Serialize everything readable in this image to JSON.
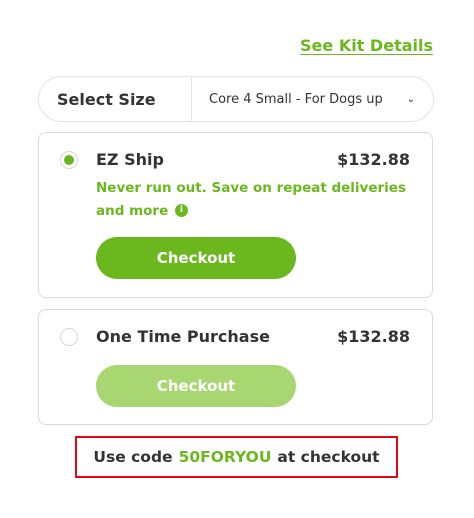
{
  "kit_link": "See Kit Details",
  "size": {
    "label": "Select Size",
    "selected": "Core 4 Small - For Dogs up"
  },
  "options": [
    {
      "title": "EZ Ship",
      "price": "$132.88",
      "selected": true,
      "promo": "Never run out. Save on repeat deliveries and more",
      "button": "Checkout"
    },
    {
      "title": "One Time Purchase",
      "price": "$132.88",
      "selected": false,
      "button": "Checkout"
    }
  ],
  "code_banner": {
    "prefix": "Use code",
    "code": "50FORYOU",
    "suffix": "at checkout"
  },
  "colors": {
    "accent": "#6bb81e",
    "accent_light": "#a8d670",
    "highlight_border": "#e30613"
  },
  "icons": {
    "info": "info-icon",
    "chevron": "chevron-down-icon"
  }
}
